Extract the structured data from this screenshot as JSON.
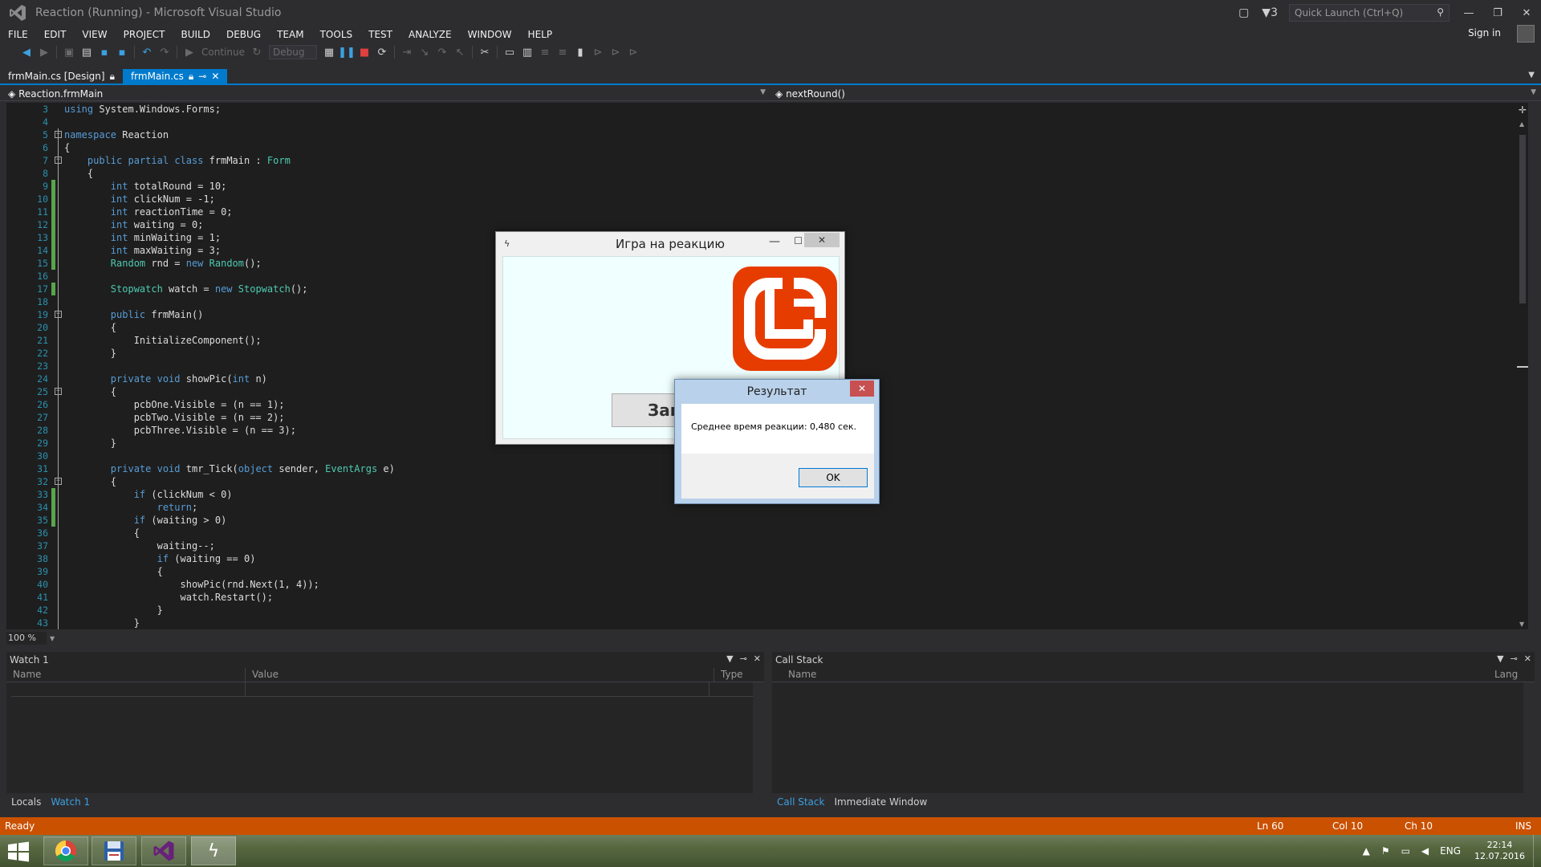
{
  "window": {
    "title": "Reaction (Running) - Microsoft Visual Studio",
    "notifications_count": "3",
    "quick_launch_placeholder": "Quick Launch (Ctrl+Q)",
    "sign_in": "Sign in"
  },
  "menu": [
    "FILE",
    "EDIT",
    "VIEW",
    "PROJECT",
    "BUILD",
    "DEBUG",
    "TEAM",
    "TOOLS",
    "TEST",
    "ANALYZE",
    "WINDOW",
    "HELP"
  ],
  "toolbar": {
    "continue_label": "Continue",
    "config_value": "Debug"
  },
  "tabs": [
    {
      "label": "frmMain.cs [Design]",
      "active": false
    },
    {
      "label": "frmMain.cs",
      "active": true
    }
  ],
  "navbar": {
    "left": "Reaction.frmMain",
    "right": "nextRound()"
  },
  "editor": {
    "line_numbers": [
      "3",
      "4",
      "5",
      "6",
      "7",
      "8",
      "9",
      "10",
      "11",
      "12",
      "13",
      "14",
      "15",
      "16",
      "17",
      "18",
      "19",
      "20",
      "21",
      "22",
      "23",
      "24",
      "25",
      "26",
      "27",
      "28",
      "29",
      "30",
      "31",
      "32",
      "33",
      "34",
      "35",
      "36",
      "37",
      "38",
      "39",
      "40",
      "41",
      "42",
      "43"
    ],
    "lines": [
      "using System.Windows.Forms;",
      "",
      "namespace Reaction",
      "{",
      "    public partial class frmMain : Form",
      "    {",
      "        int totalRound = 10;",
      "        int clickNum = -1;",
      "        int reactionTime = 0;",
      "        int waiting = 0;",
      "        int minWaiting = 1;",
      "        int maxWaiting = 3;",
      "        Random rnd = new Random();",
      "",
      "        Stopwatch watch = new Stopwatch();",
      "",
      "        public frmMain()",
      "        {",
      "            InitializeComponent();",
      "        }",
      "",
      "        private void showPic(int n)",
      "        {",
      "            pcbOne.Visible = (n == 1);",
      "            pcbTwo.Visible = (n == 2);",
      "            pcbThree.Visible = (n == 3);",
      "        }",
      "",
      "        private void tmr_Tick(object sender, EventArgs e)",
      "        {",
      "            if (clickNum < 0)",
      "                return;",
      "            if (waiting > 0)",
      "            {",
      "                waiting--;",
      "                if (waiting == 0)",
      "                {",
      "                    showPic(rnd.Next(1, 4));",
      "                    watch.Restart();",
      "                }",
      "            }"
    ],
    "zoom": "100 %"
  },
  "watch_panel": {
    "title": "Watch 1",
    "columns": [
      "Name",
      "Value",
      "Type"
    ],
    "tabs": [
      "Locals",
      "Watch 1"
    ]
  },
  "callstack_panel": {
    "title": "Call Stack",
    "columns": [
      "Name",
      "Lang"
    ],
    "tabs": [
      "Call Stack",
      "Immediate Window"
    ]
  },
  "status": {
    "text": "Ready",
    "ln": "Ln 60",
    "col": "Col 10",
    "ch": "Ch 10",
    "mode": "INS"
  },
  "app_window": {
    "title": "Игра на реакцию",
    "button_label": "Запу"
  },
  "msgbox": {
    "title": "Результат",
    "text": "Среднее время реакции: 0,480 сек.",
    "ok_label": "OK"
  },
  "taskbar": {
    "lang": "ENG",
    "time": "22:14",
    "date": "12.07.2016"
  },
  "colors": {
    "accent": "#007acc",
    "status_bar": "#ca5100",
    "editor_bg": "#1e1e1e",
    "keyword": "#569cd6",
    "type": "#4ec9b0"
  }
}
